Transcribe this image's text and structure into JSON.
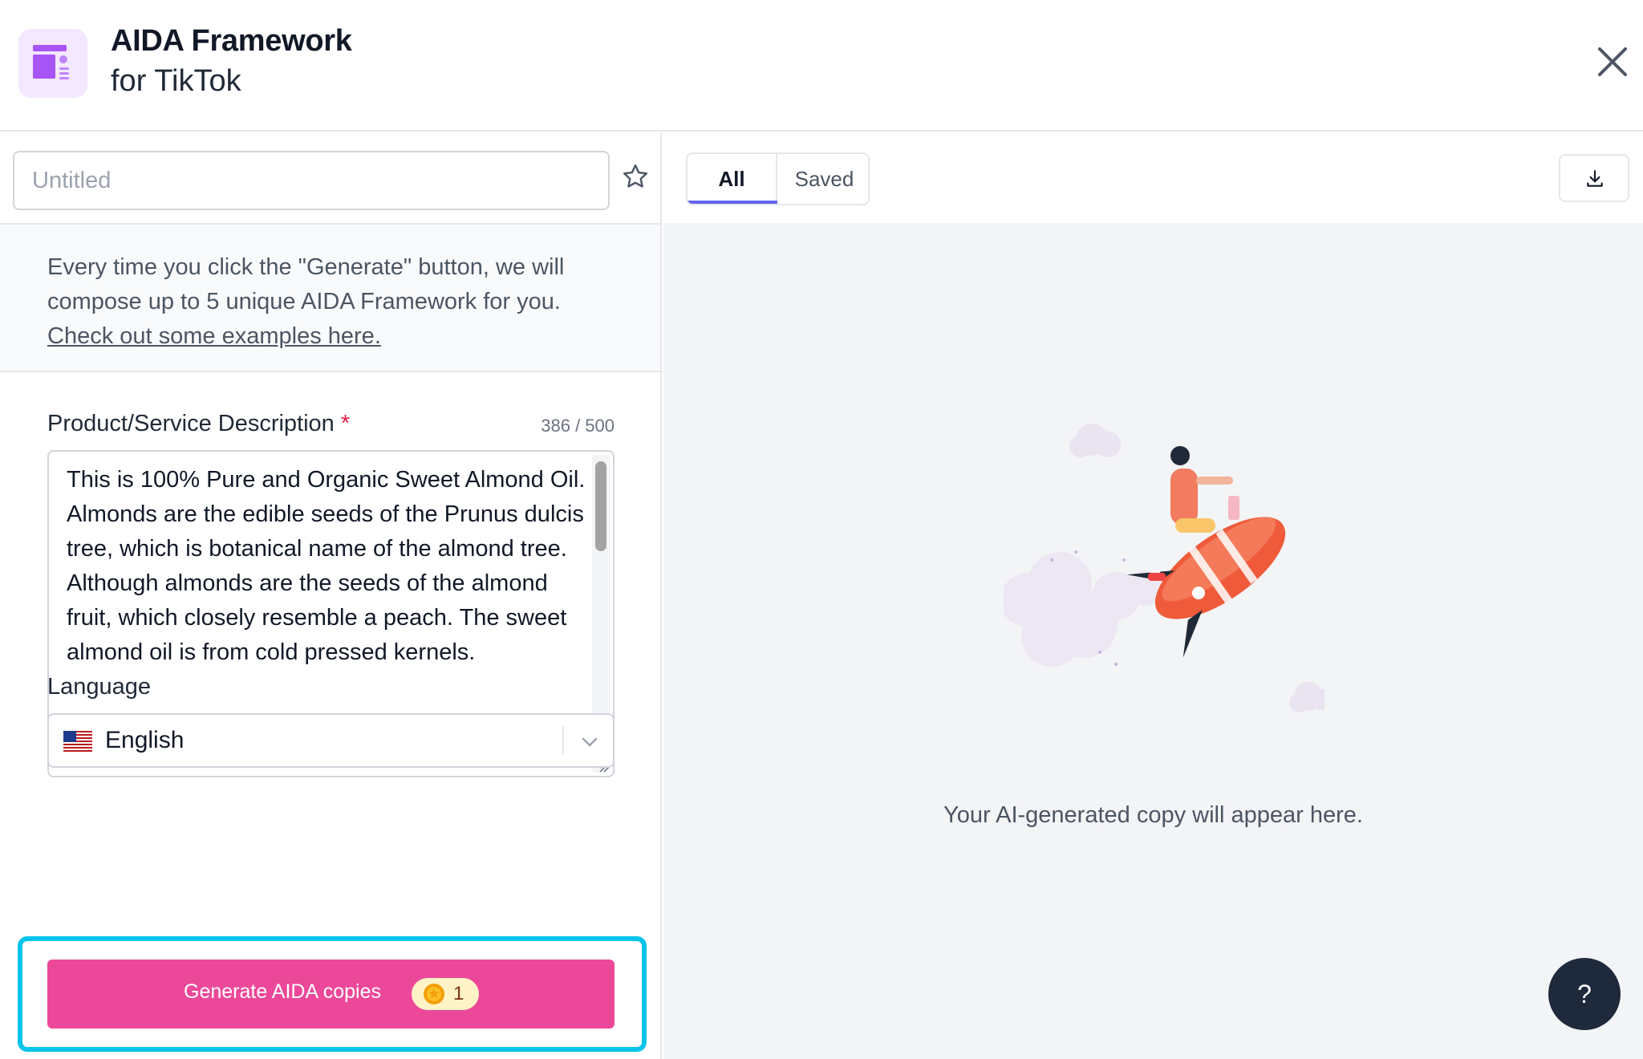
{
  "header": {
    "title": "AIDA Framework",
    "subtitle": "for TikTok",
    "app_icon": "layout-template-icon",
    "close_icon": "close-icon"
  },
  "left_panel": {
    "name_input": {
      "placeholder": "Untitled",
      "value": ""
    },
    "favorite_icon": "star-outline-icon",
    "info": {
      "text": "Every time you click the \"Generate\" button, we will compose up to 5 unique AIDA Framework for you. ",
      "link": "Check out some examples here."
    },
    "description": {
      "label": "Product/Service Description",
      "required_mark": "*",
      "counter": "386 / 500",
      "value": "This is 100% Pure and Organic Sweet Almond Oil. Almonds are the edible seeds of the Prunus dulcis tree, which is botanical name of the almond tree. Although almonds are the seeds of the almond fruit, which closely resemble a peach. The sweet almond oil is from cold pressed kernels."
    },
    "language": {
      "label": "Language",
      "selected": "English",
      "flag_icon": "us-flag-icon"
    },
    "generate": {
      "label": "Generate AIDA copies",
      "credits": "1",
      "coin_icon": "coin-icon"
    }
  },
  "right_panel": {
    "tabs": [
      {
        "label": "All",
        "active": true
      },
      {
        "label": "Saved",
        "active": false
      }
    ],
    "download_icon": "download-icon",
    "empty_state": "Your AI-generated copy will appear here.",
    "help_label": "?"
  },
  "colors": {
    "accent_pink": "#ec4899",
    "highlight_cyan": "#06c4ea",
    "tab_indicator": "#6366f1",
    "required_red": "#e11d48"
  }
}
